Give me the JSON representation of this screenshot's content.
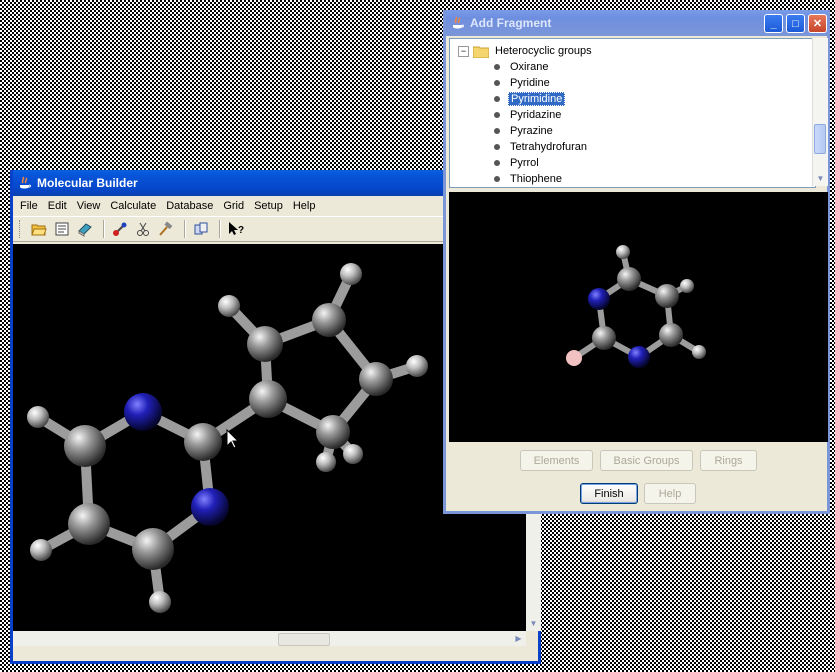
{
  "molecular_builder": {
    "title": "Molecular Builder",
    "menu": [
      "File",
      "Edit",
      "View",
      "Calculate",
      "Database",
      "Grid",
      "Setup",
      "Help"
    ],
    "toolbar_icons": [
      "open-icon",
      "save-icon",
      "book-icon",
      "bond-icon",
      "scissors-icon",
      "hammer-icon",
      "copy-icon",
      "help-pointer-icon"
    ]
  },
  "add_fragment": {
    "title": "Add Fragment",
    "tree": {
      "group": "Heterocyclic groups",
      "items": [
        "Oxirane",
        "Pyridine",
        "Pyrimidine",
        "Pyridazine",
        "Pyrazine",
        "Tetrahydrofuran",
        "Pyrrol",
        "Thiophene"
      ],
      "selected": "Pyrimidine"
    },
    "buttons": {
      "elements": "Elements",
      "basic_groups": "Basic Groups",
      "rings": "Rings",
      "finish": "Finish",
      "help": "Help"
    }
  },
  "colors": {
    "carbon": "#8a8a8a",
    "nitrogen": "#2020b8",
    "hydrogen": "#d0d0d0",
    "attach_point": "#f0c0c0",
    "selection": "#316ac5"
  }
}
